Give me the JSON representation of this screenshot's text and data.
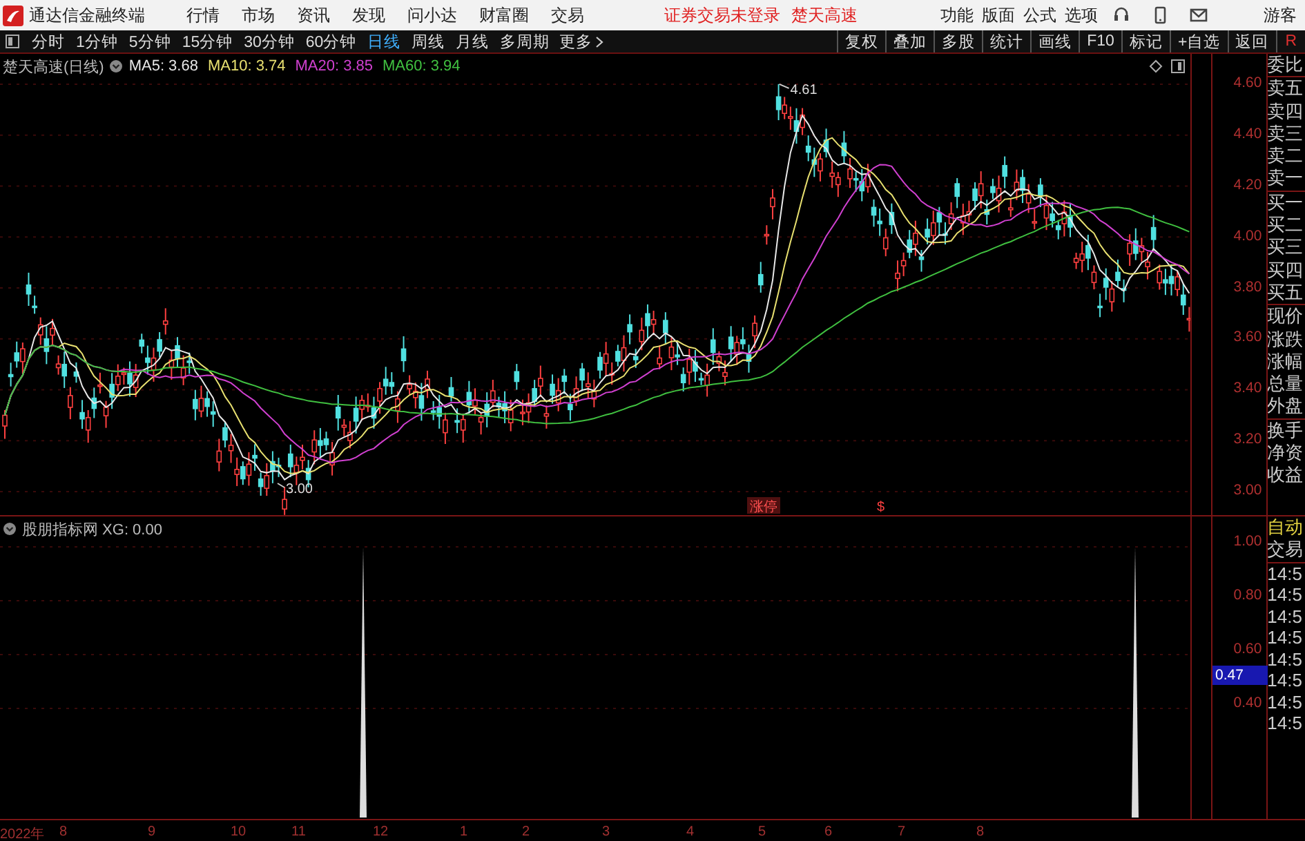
{
  "title_bar": {
    "app_name": "通达信金融终端",
    "menu": [
      "行情",
      "市场",
      "资讯",
      "发现",
      "问小达",
      "财富圈",
      "交易"
    ],
    "notices": [
      "证券交易未登录",
      "楚天高速"
    ],
    "tools": [
      "功能",
      "版面",
      "公式",
      "选项"
    ],
    "user": "游客"
  },
  "toolbar": {
    "periods": [
      {
        "label": "分时",
        "selected": false
      },
      {
        "label": "1分钟",
        "selected": false
      },
      {
        "label": "5分钟",
        "selected": false
      },
      {
        "label": "15分钟",
        "selected": false
      },
      {
        "label": "30分钟",
        "selected": false
      },
      {
        "label": "60分钟",
        "selected": false
      },
      {
        "label": "日线",
        "selected": true
      },
      {
        "label": "周线",
        "selected": false
      },
      {
        "label": "月线",
        "selected": false
      },
      {
        "label": "多周期",
        "selected": false
      }
    ],
    "more": "更多",
    "buttons": [
      "复权",
      "叠加",
      "多股",
      "统计",
      "画线",
      "F10",
      "标记",
      "+自选",
      "返回"
    ],
    "corner": "R"
  },
  "main_chart": {
    "title": "楚天高速(日线)",
    "indicators": [
      {
        "label": "MA5: 3.68",
        "color": "#e8e8e8"
      },
      {
        "label": "MA10: 3.74",
        "color": "#e8e070"
      },
      {
        "label": "MA20: 3.85",
        "color": "#d040d0"
      },
      {
        "label": "MA60: 3.94",
        "color": "#40c040"
      }
    ],
    "price_axis": [
      "4.60",
      "4.40",
      "4.20",
      "4.00",
      "3.80",
      "3.60",
      "3.40",
      "3.20",
      "3.00"
    ],
    "high_label": "4.61",
    "low_label": "3.00",
    "limit_up_tag": "涨停",
    "marker": "$"
  },
  "quote_panel": {
    "groups": [
      [
        "委比"
      ],
      [
        "卖五",
        "卖四",
        "卖三",
        "卖二",
        "卖一"
      ],
      [
        "买一",
        "买二",
        "买三",
        "买四",
        "买五"
      ],
      [
        "现价",
        "涨跌",
        "涨幅",
        "总量",
        "外盘"
      ],
      [
        "换手",
        "净资",
        "收益"
      ]
    ]
  },
  "indicator_pane": {
    "title": "股朋指标网 XG: 0.00",
    "axis": [
      "1.00",
      "0.80",
      "0.60",
      "0.40"
    ],
    "cursor_value": "0.47"
  },
  "trade_panel": {
    "labels": [
      "自动",
      "交易"
    ],
    "times": [
      "14:5",
      "14:5",
      "14:5",
      "14:5",
      "14:5",
      "14:5",
      "14:5",
      "14:5"
    ]
  },
  "date_axis": [
    "2022年",
    "8",
    "9",
    "10",
    "11",
    "12",
    "1",
    "2",
    "3",
    "4",
    "5",
    "6",
    "7",
    "8"
  ]
}
